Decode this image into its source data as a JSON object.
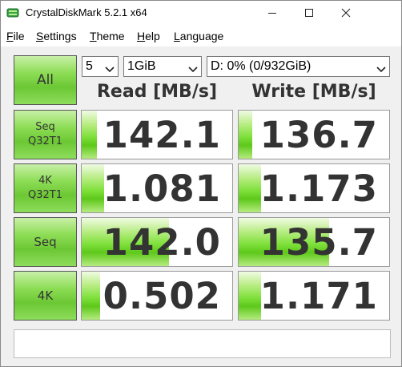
{
  "titlebar": {
    "title": "CrystalDiskMark 5.2.1 x64",
    "minimize_glyph": "—",
    "maximize_glyph": "☐",
    "close_glyph": "✕"
  },
  "menu": {
    "items": [
      {
        "label": "File",
        "mnemonic": "F",
        "rest": "ile"
      },
      {
        "label": "Settings",
        "mnemonic": "S",
        "rest": "ettings"
      },
      {
        "label": "Theme",
        "mnemonic": "T",
        "rest": "heme"
      },
      {
        "label": "Help",
        "mnemonic": "H",
        "rest": "elp"
      },
      {
        "label": "Language",
        "mnemonic": "L",
        "rest": "anguage"
      }
    ]
  },
  "controls": {
    "all_button": "All",
    "count_value": "5",
    "size_value": "1GiB",
    "drive_value": "D: 0% (0/932GiB)"
  },
  "headers": {
    "read": "Read [MB/s]",
    "write": "Write [MB/s]"
  },
  "tests": [
    {
      "line1": "Seq",
      "line2": "Q32T1",
      "read": "142.1",
      "write": "136.7",
      "read_fill": 0.1,
      "write_fill": 0.09
    },
    {
      "line1": "4K",
      "line2": "Q32T1",
      "read": "1.081",
      "write": "1.173",
      "read_fill": 0.15,
      "write_fill": 0.15
    },
    {
      "line1": "Seq",
      "line2": "",
      "read": "142.0",
      "write": "135.7",
      "read_fill": 0.58,
      "write_fill": 0.6
    },
    {
      "line1": "4K",
      "line2": "",
      "read": "0.502",
      "write": "1.171",
      "read_fill": 0.12,
      "write_fill": 0.15
    }
  ],
  "status_text": "",
  "colors": {
    "accent_green": "#6cc734",
    "text": "#333333"
  }
}
